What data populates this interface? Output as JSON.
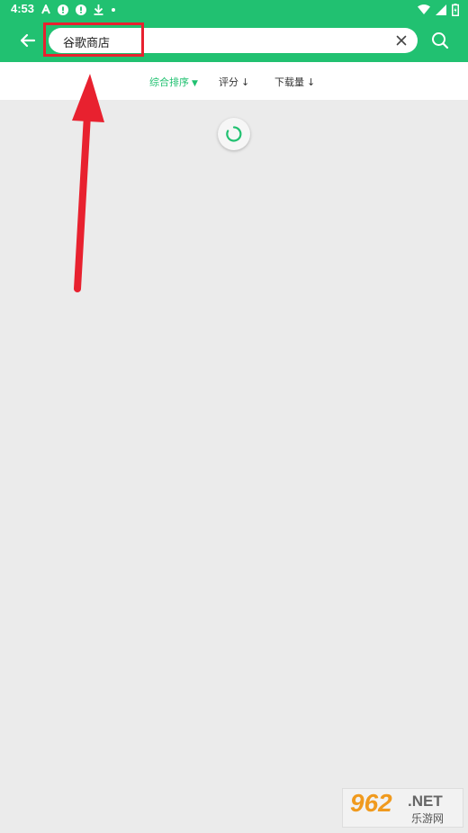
{
  "status_bar": {
    "time": "4:53",
    "left_icons": [
      "text-a-icon",
      "alert-icon",
      "alert-icon",
      "download-icon",
      "dot-icon"
    ],
    "right_icons": [
      "wifi-icon",
      "signal-icon",
      "battery-charging-icon"
    ]
  },
  "search": {
    "query": "谷歌商店"
  },
  "sort_tabs": [
    {
      "label": "综合排序",
      "arrow": "▼"
    },
    {
      "label": "评分",
      "arrow": "↓"
    },
    {
      "label": "下载量",
      "arrow": "↓"
    }
  ],
  "watermark": {
    "number": "962",
    "net": ".NET",
    "cn": "乐游网"
  },
  "colors": {
    "brand_green": "#21c171",
    "highlight_red": "#e8212f"
  }
}
